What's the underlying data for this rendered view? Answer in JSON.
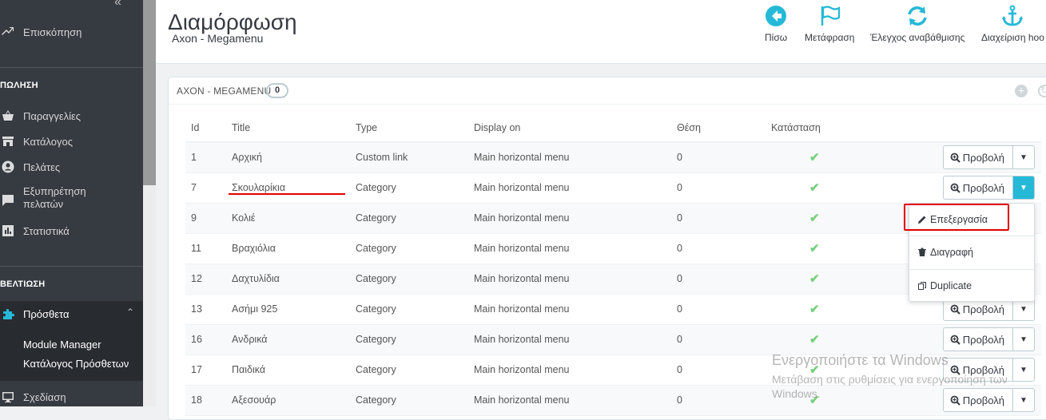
{
  "sidebar": {
    "overview": "Επισκόπηση",
    "section_sell": "ΠΩΛΗΣΗ",
    "orders": "Παραγγελίες",
    "catalog": "Κατάλογος",
    "customers": "Πελάτες",
    "service": "Εξυπηρέτηση πελατών",
    "stats": "Στατιστικά",
    "section_improve": "ΒΕΛΤΙΩΣΗ",
    "modules": "Πρόσθετα",
    "module_manager": "Module Manager",
    "module_catalog": "Κατάλογος Πρόσθετων",
    "design": "Σχεδίαση"
  },
  "header": {
    "title": "Διαμόρφωση",
    "subtitle": "Axon - Megamenu",
    "toolbar": {
      "back": "Πίσω",
      "translate": "Μετάφραση",
      "check_update": "Έλεγχος αναβάθμισης",
      "hooks": "Διαχείριση hoo"
    }
  },
  "panel": {
    "title": "AXON - MEGAMENU",
    "count": "0"
  },
  "table": {
    "columns": [
      "Id",
      "Title",
      "Type",
      "Display on",
      "Θέση",
      "Κατάσταση"
    ],
    "view_label": "Προβολή",
    "rows": [
      {
        "id": "1",
        "title": "Αρχική",
        "type": "Custom link",
        "display": "Main horizontal menu",
        "pos": "0"
      },
      {
        "id": "7",
        "title": "Σκουλαρίκια",
        "type": "Category",
        "display": "Main horizontal menu",
        "pos": "0"
      },
      {
        "id": "9",
        "title": "Κολιέ",
        "type": "Category",
        "display": "Main horizontal menu",
        "pos": "0"
      },
      {
        "id": "11",
        "title": "Βραχιόλια",
        "type": "Category",
        "display": "Main horizontal menu",
        "pos": "0"
      },
      {
        "id": "12",
        "title": "Δαχτυλίδια",
        "type": "Category",
        "display": "Main horizontal menu",
        "pos": "0"
      },
      {
        "id": "13",
        "title": "Ασήμι 925",
        "type": "Category",
        "display": "Main horizontal menu",
        "pos": "0"
      },
      {
        "id": "16",
        "title": "Ανδρικά",
        "type": "Category",
        "display": "Main horizontal menu",
        "pos": "0"
      },
      {
        "id": "17",
        "title": "Παιδικά",
        "type": "Category",
        "display": "Main horizontal menu",
        "pos": "0"
      },
      {
        "id": "18",
        "title": "Αξεσουάρ",
        "type": "Category",
        "display": "Main horizontal menu",
        "pos": "0"
      }
    ]
  },
  "dropdown": {
    "edit": "Επεξεργασία",
    "delete": "Διαγραφή",
    "duplicate": "Duplicate"
  },
  "watermark": {
    "line1": "Ενεργοποιήστε τα Windows",
    "line2": "Μετάβαση στις ρυθμίσεις για ενεργοποίηση των Windows."
  },
  "colors": {
    "sidebar_bg": "#363a41",
    "accent": "#25b9d7",
    "toolbar_icon": "#25b9d7",
    "check": "#78d07d",
    "highlight": "#e30000"
  }
}
